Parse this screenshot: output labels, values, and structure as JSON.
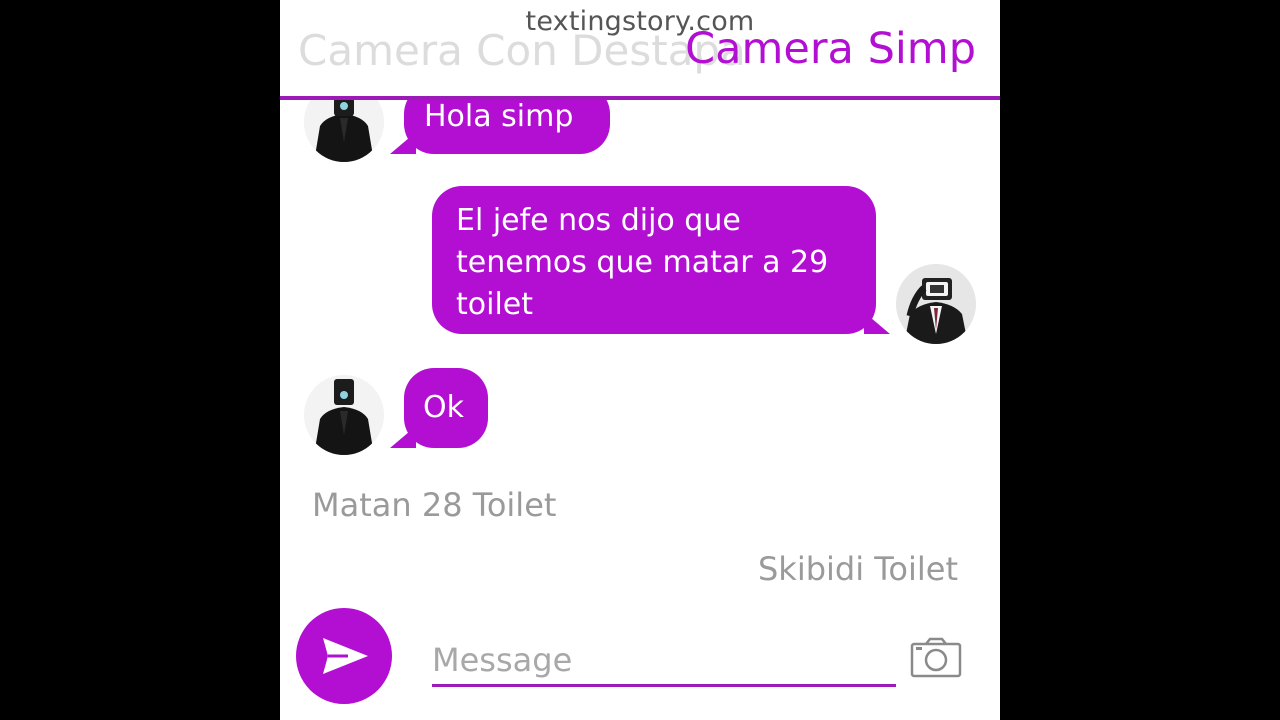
{
  "watermark": "textingstory.com",
  "header": {
    "faded_title": "Camera Con Destapa",
    "title": "Camera Simp"
  },
  "messages": [
    {
      "sender": "Camera Con Destapa",
      "side": "left",
      "text": "Hola simp"
    },
    {
      "sender": "Camera Simp",
      "side": "right",
      "lines": [
        "El jefe nos dijo que",
        "tenemos que matar a 29",
        "toilet"
      ]
    },
    {
      "sender": "Camera Con Destapa",
      "side": "left",
      "text": "Ok"
    }
  ],
  "narration": [
    {
      "text": "Matan 28 Toilet",
      "align": "left"
    },
    {
      "text": "Skibidi Toilet",
      "align": "right"
    }
  ],
  "composer": {
    "placeholder": "Message",
    "send_icon": "send-icon",
    "camera_icon": "camera-icon"
  },
  "colors": {
    "accent": "#b20fd3",
    "header_line": "#9c1ab8",
    "narration_text": "#9a9a9a"
  }
}
